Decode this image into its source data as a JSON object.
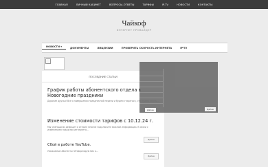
{
  "topnav": {
    "items": [
      {
        "label": "Главная"
      },
      {
        "label": "Личный кабинет"
      },
      {
        "label": "Вопросы-ответы"
      },
      {
        "label": "Тарифы"
      },
      {
        "label": "IP-TV"
      },
      {
        "label": "Новости"
      },
      {
        "label": "Контакты"
      }
    ]
  },
  "site": {
    "title": "Чайкоф",
    "subtitle": "Интернет провайдер"
  },
  "mainnav": {
    "items": [
      {
        "label": "Новости ▾"
      },
      {
        "label": "Документы"
      },
      {
        "label": "Лицензии"
      },
      {
        "label": "Проверить скорость интернета"
      },
      {
        "label": "IP-TV"
      }
    ]
  },
  "content": {
    "section_title": "Последние статьи",
    "posts": [
      {
        "title": "График работы абонентского отдела в Новогодние праздники",
        "excerpt": "Дорогие друзья! Всё о завершении праздничной недели и будем стараться, что нужно знать...",
        "more_label": "Далее"
      },
      {
        "title": "Изменение стоимости тарифов с 10.12.24 г.",
        "excerpt": "Мы уменьшили дефицит и отныне многие подключите важной информации. В связи с изменением покрытия интернета...",
        "more_label": "Далее"
      },
      {
        "title": "Сбой в работе YouTube.",
        "excerpt": "Уважаемые абоненты! Информирую Вас о...",
        "more_label": "Далее"
      }
    ]
  },
  "overlay": {
    "left_button_label": "Далее",
    "right_button_label": "Далее"
  },
  "colors": {
    "topbar": "#3c3c3c",
    "page_bg": "#ececec",
    "overlay": "#6f6f6f"
  }
}
